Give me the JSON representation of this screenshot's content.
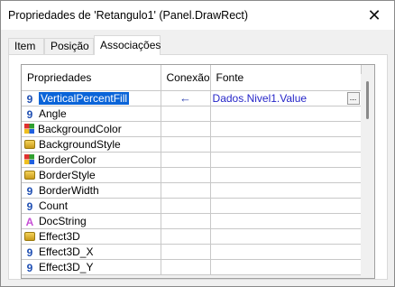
{
  "window": {
    "title": "Propriedades de 'Retangulo1' (Panel.DrawRect)",
    "close_label": "✕"
  },
  "tabs": [
    {
      "label": "Item",
      "active": false
    },
    {
      "label": "Posição",
      "active": false
    },
    {
      "label": "Associações",
      "active": true
    }
  ],
  "grid": {
    "columns": [
      "Propriedades",
      "Conexão",
      "Fonte"
    ],
    "rows": [
      {
        "icon": "numeric-icon",
        "name": "VerticalPercentFill",
        "link": "←",
        "source": "Dados.Nivel1.Value",
        "selected": true
      },
      {
        "icon": "numeric-icon",
        "name": "Angle",
        "link": "",
        "source": ""
      },
      {
        "icon": "color-icon",
        "name": "BackgroundColor",
        "link": "",
        "source": ""
      },
      {
        "icon": "style-icon",
        "name": "BackgroundStyle",
        "link": "",
        "source": ""
      },
      {
        "icon": "color-icon",
        "name": "BorderColor",
        "link": "",
        "source": ""
      },
      {
        "icon": "style-icon",
        "name": "BorderStyle",
        "link": "",
        "source": ""
      },
      {
        "icon": "numeric-icon",
        "name": "BorderWidth",
        "link": "",
        "source": ""
      },
      {
        "icon": "numeric-icon",
        "name": "Count",
        "link": "",
        "source": ""
      },
      {
        "icon": "string-icon",
        "name": "DocString",
        "link": "",
        "source": ""
      },
      {
        "icon": "style-icon",
        "name": "Effect3D",
        "link": "",
        "source": ""
      },
      {
        "icon": "numeric-icon",
        "name": "Effect3D_X",
        "link": "",
        "source": ""
      },
      {
        "icon": "numeric-icon",
        "name": "Effect3D_Y",
        "link": "",
        "source": ""
      }
    ],
    "ellipsis_label": "..."
  },
  "glyphs": {
    "numeric-icon": "9",
    "string-icon": "A"
  },
  "colors": {
    "selection": "#0a64d8",
    "source_text": "#2626c8",
    "numeric_icon": "#1f4fb3",
    "string_icon": "#c64fd6"
  }
}
